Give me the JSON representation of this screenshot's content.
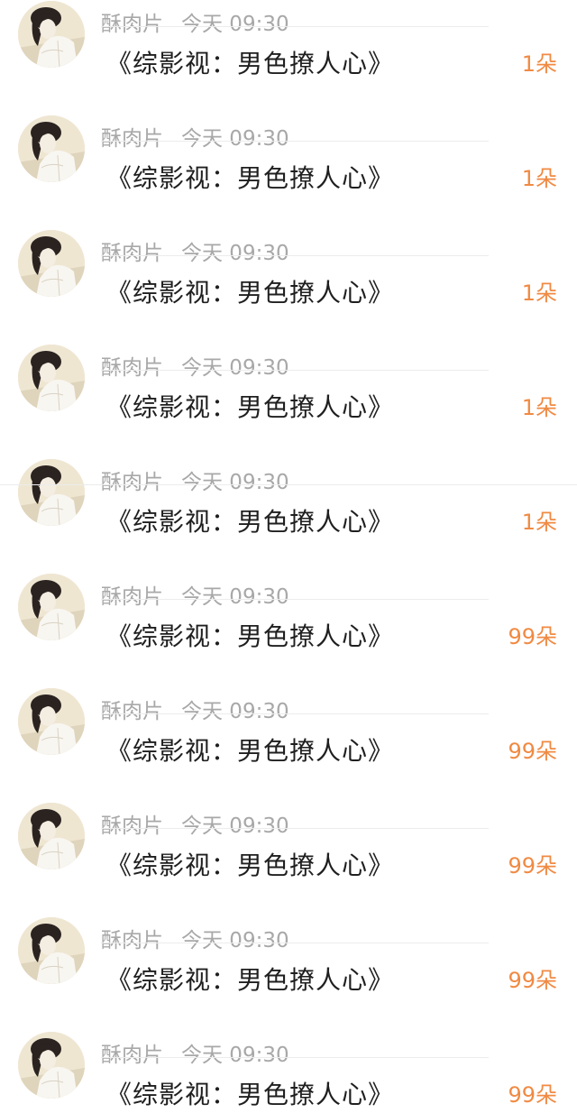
{
  "theme": {
    "meta_color": "#a8a8a8",
    "title_color": "#1f1f1f",
    "count_color": "#f08a43"
  },
  "list": {
    "items": [
      {
        "avatar_icon": "avatar-woman-portrait-icon",
        "name": "酥肉片",
        "time": "今天 09:30",
        "title": "《综影视：男色撩人心》",
        "count": "1朵"
      },
      {
        "avatar_icon": "avatar-woman-portrait-icon",
        "name": "酥肉片",
        "time": "今天 09:30",
        "title": "《综影视：男色撩人心》",
        "count": "1朵"
      },
      {
        "avatar_icon": "avatar-woman-portrait-icon",
        "name": "酥肉片",
        "time": "今天 09:30",
        "title": "《综影视：男色撩人心》",
        "count": "1朵"
      },
      {
        "avatar_icon": "avatar-woman-portrait-icon",
        "name": "酥肉片",
        "time": "今天 09:30",
        "title": "《综影视：男色撩人心》",
        "count": "1朵"
      },
      {
        "avatar_icon": "avatar-woman-portrait-icon",
        "name": "酥肉片",
        "time": "今天 09:30",
        "title": "《综影视：男色撩人心》",
        "count": "1朵"
      },
      {
        "avatar_icon": "avatar-woman-portrait-icon",
        "name": "酥肉片",
        "time": "今天 09:30",
        "title": "《综影视：男色撩人心》",
        "count": "99朵"
      },
      {
        "avatar_icon": "avatar-woman-portrait-icon",
        "name": "酥肉片",
        "time": "今天 09:30",
        "title": "《综影视：男色撩人心》",
        "count": "99朵"
      },
      {
        "avatar_icon": "avatar-woman-portrait-icon",
        "name": "酥肉片",
        "time": "今天 09:30",
        "title": "《综影视：男色撩人心》",
        "count": "99朵"
      },
      {
        "avatar_icon": "avatar-woman-portrait-icon",
        "name": "酥肉片",
        "time": "今天 09:30",
        "title": "《综影视：男色撩人心》",
        "count": "99朵"
      },
      {
        "avatar_icon": "avatar-woman-portrait-icon",
        "name": "酥肉片",
        "time": "今天 09:30",
        "title": "《综影视：男色撩人心》",
        "count": "99朵"
      }
    ]
  }
}
